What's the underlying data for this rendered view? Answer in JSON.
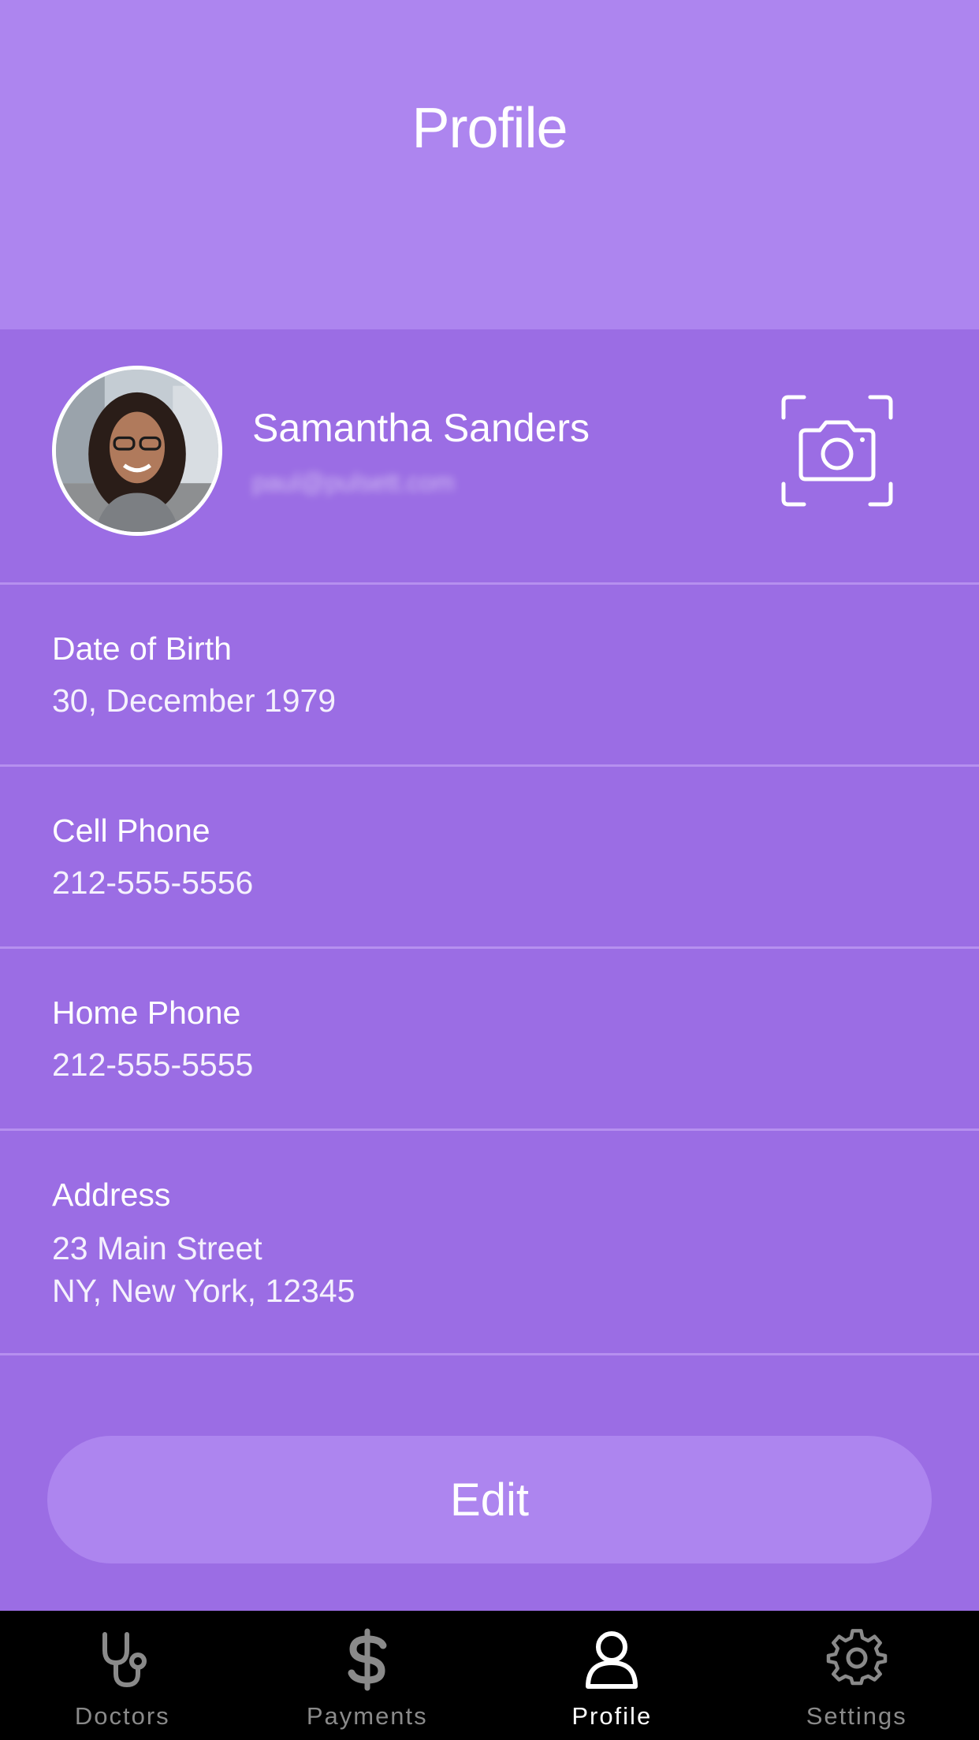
{
  "header": {
    "title": "Profile"
  },
  "profile": {
    "name": "Samantha Sanders",
    "email": "paul@pulsett.com"
  },
  "fields": [
    {
      "label": "Date of Birth",
      "value": "30, December 1979"
    },
    {
      "label": "Cell Phone",
      "value": "212-555-5556"
    },
    {
      "label": "Home Phone",
      "value": "212-555-5555"
    },
    {
      "label": "Address",
      "value_line1": "23 Main Street",
      "value_line2": "NY, New York, 12345"
    }
  ],
  "edit_button": {
    "label": "Edit"
  },
  "tabbar": {
    "items": [
      {
        "label": "Doctors",
        "icon": "stethoscope-icon",
        "active": false
      },
      {
        "label": "Payments",
        "icon": "dollar-icon",
        "active": false
      },
      {
        "label": "Profile",
        "icon": "person-icon",
        "active": true
      },
      {
        "label": "Settings",
        "icon": "gear-icon",
        "active": false
      }
    ]
  },
  "colors": {
    "header_bg": "#ad85ef",
    "body_bg": "#9b6de4",
    "divider": "#b690ef",
    "tabbar_bg": "#000000",
    "tab_inactive": "#8a8a8a",
    "tab_active": "#ffffff"
  }
}
